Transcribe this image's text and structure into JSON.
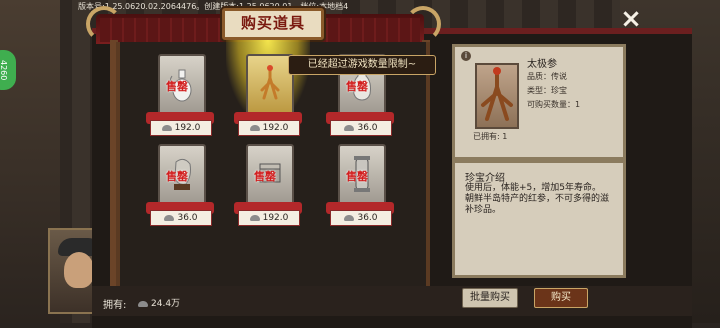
{
  "version_text": "版本号:1.25.0620.02.2064476。创建版本:1.25.0620.01，档位:本地档4",
  "side_badge": "4260",
  "close_icon": "×",
  "title": "购买道具",
  "limit_tooltip": "已经超过游戏数量限制~",
  "items": [
    {
      "name": "white-pot",
      "price": "192.0",
      "sold": "售罄",
      "icon": "porcelain-pot-icon"
    },
    {
      "name": "ginseng",
      "price": "192.0",
      "sold": "",
      "icon": "ginseng-icon",
      "selected": true
    },
    {
      "name": "vase",
      "price": "36.0",
      "sold": "售罄",
      "icon": "vase-icon"
    },
    {
      "name": "stone",
      "price": "36.0",
      "sold": "售罄",
      "icon": "stone-icon"
    },
    {
      "name": "box",
      "price": "192.0",
      "sold": "售罄",
      "icon": "box-icon"
    },
    {
      "name": "scroll",
      "price": "36.0",
      "sold": "售罄",
      "icon": "scroll-icon"
    }
  ],
  "detail": {
    "name": "太极参",
    "quality_label": "品质：",
    "quality": "传说",
    "type_label": "类型：",
    "type": "珍宝",
    "buyable_label": "可购买数量：",
    "buyable": "1",
    "owned": "已拥有: 1"
  },
  "description": {
    "title": "珍宝介绍",
    "line1": "使用后，体能+5，增加5年寿命。",
    "line2": "朝鲜半岛特产的红参，不可多得的滋补珍品。"
  },
  "bottom": {
    "owned_label": "拥有:",
    "owned_value": "24.4万",
    "bulk_buy": "批量购买",
    "buy": "购买"
  }
}
